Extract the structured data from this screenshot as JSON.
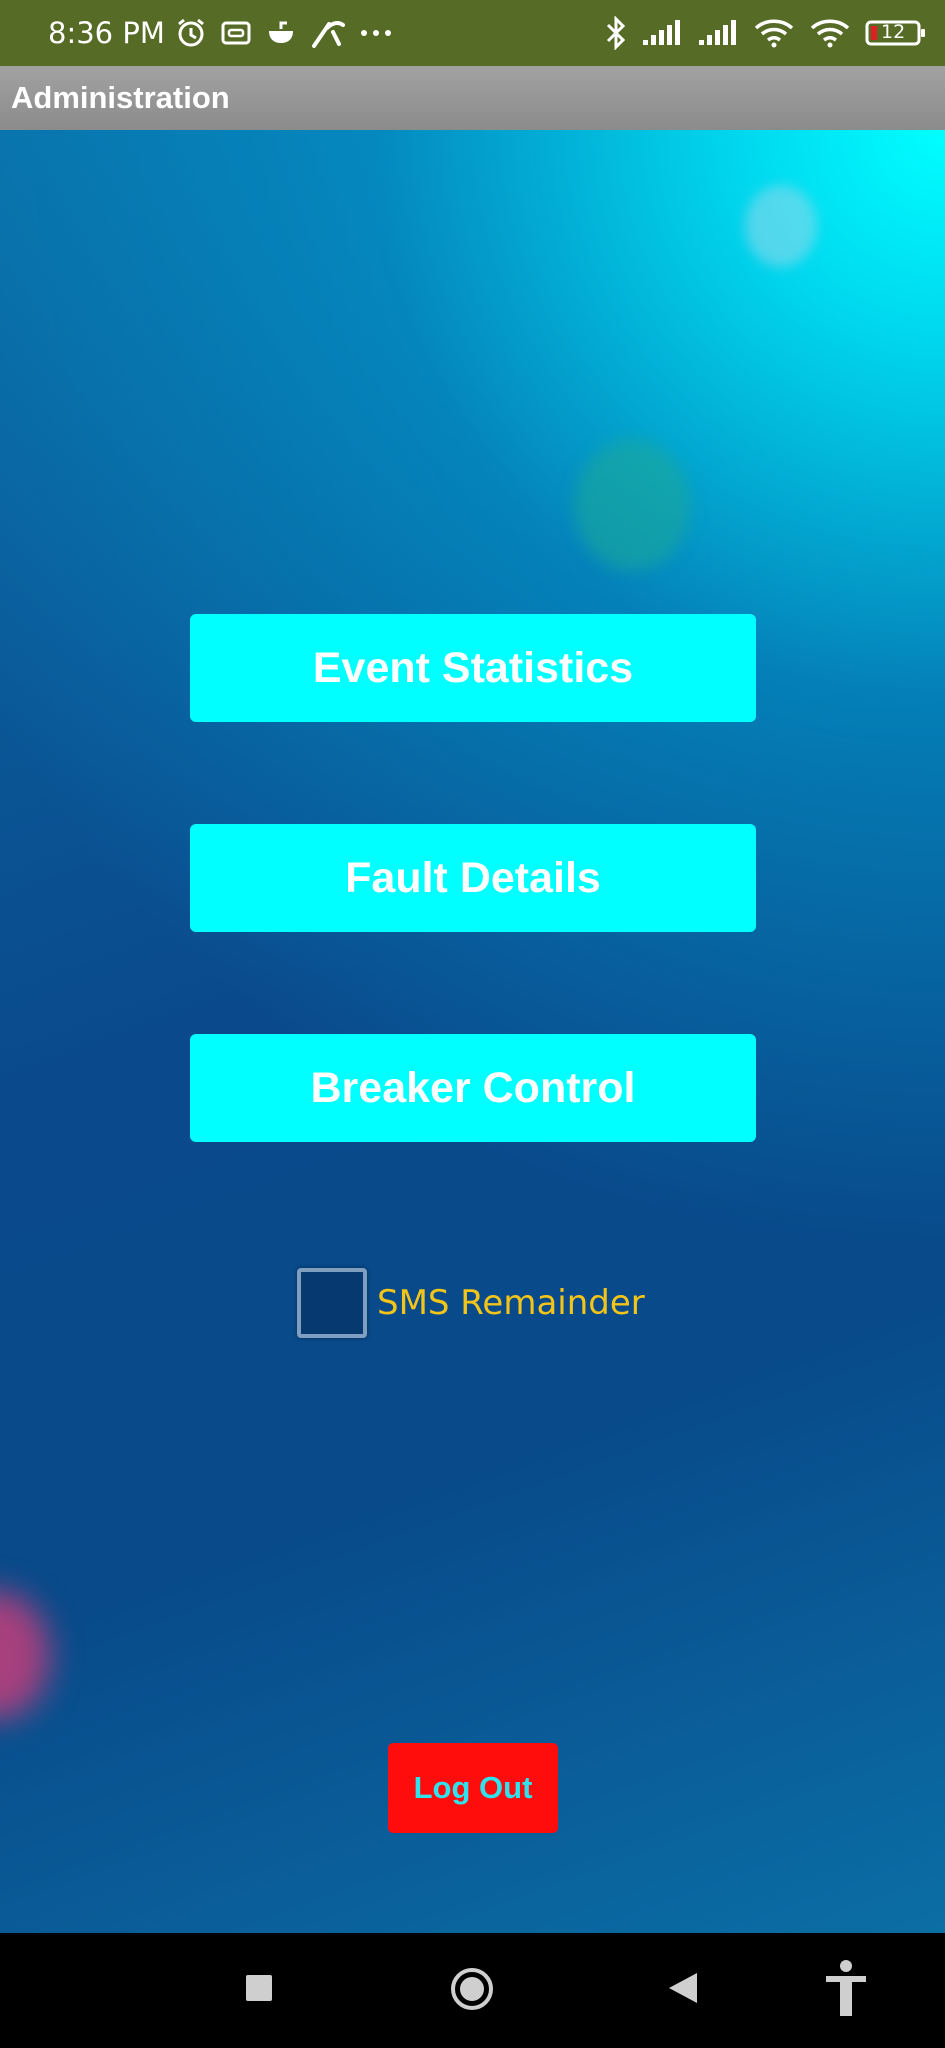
{
  "status_bar": {
    "time": "8:36 PM",
    "battery_level": "12",
    "left_icons": [
      "alarm-icon",
      "vr-icon",
      "cloud-icon",
      "carrier-logo-icon",
      "more-dots-icon"
    ],
    "right_icons": [
      "bluetooth-icon",
      "signal-icon",
      "signal-icon",
      "wifi-icon",
      "wifi-icon",
      "battery-icon"
    ],
    "background_color": "#566b26"
  },
  "title_bar": {
    "title": "Administration"
  },
  "menu": {
    "event_statistics": "Event Statistics",
    "fault_details": "Fault Details",
    "breaker_control": "Breaker Control",
    "button_color": "#00ffff"
  },
  "sms": {
    "label": "SMS Remainder",
    "checked": false,
    "label_color": "#f3c419"
  },
  "logout": {
    "label": "Log Out",
    "button_color": "#ff0d0d",
    "text_color": "#2ee3ee"
  },
  "nav_bar": {
    "icons": [
      "recents-icon",
      "home-icon",
      "back-icon",
      "accessibility-icon"
    ]
  }
}
